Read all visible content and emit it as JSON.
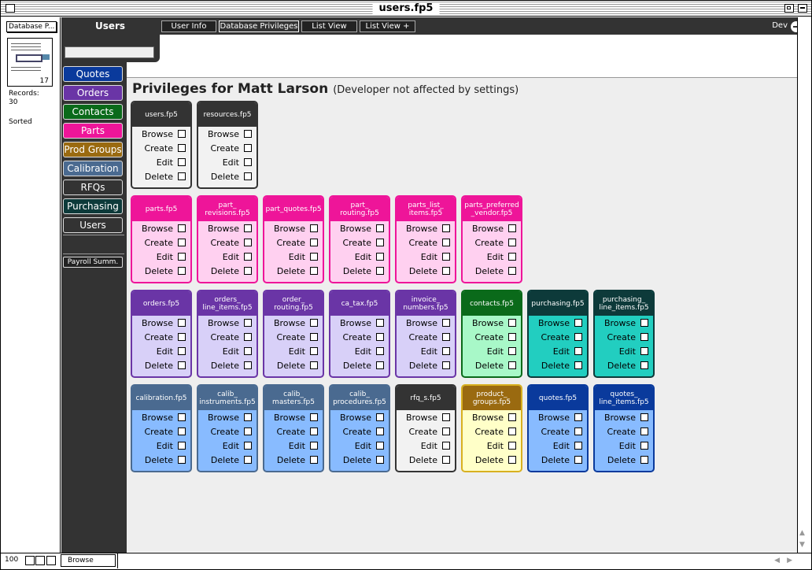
{
  "window": {
    "title": "users.fp5"
  },
  "status": {
    "db_popup": "Database P...",
    "record_num": "17",
    "records_label": "Records:",
    "records_count": "30",
    "sort_state": "Sorted"
  },
  "bottom": {
    "zoom": "100",
    "mode": "Browse"
  },
  "header": {
    "layout_title": "Users",
    "search_value": ""
  },
  "tabs": [
    {
      "label": "User Info"
    },
    {
      "label": "Database Privileges"
    },
    {
      "label": "List View"
    },
    {
      "label": "List View +"
    }
  ],
  "dev": {
    "label": "Dev"
  },
  "nav": [
    {
      "label": "Quotes",
      "color": "#0a3a9c"
    },
    {
      "label": "Orders",
      "color": "#6a35a6"
    },
    {
      "label": "Contacts",
      "color": "#0a6a1a"
    },
    {
      "label": "Parts",
      "color": "#ee1599"
    },
    {
      "label": "Prod Groups",
      "color": "#9a6a10"
    },
    {
      "label": "Calibration",
      "color": "#4a6a90"
    },
    {
      "label": "RFQs",
      "color": "#333333"
    },
    {
      "label": "Purchasing",
      "color": "#0d3a3a"
    },
    {
      "label": "Users",
      "color": "#333333"
    }
  ],
  "payroll": {
    "label": "Payroll Summ."
  },
  "main": {
    "heading": "Privileges for Matt Larson",
    "subheading": "(Developer not affected by settings)"
  },
  "row_labels": [
    "Browse",
    "Create",
    "Edit",
    "Delete"
  ],
  "cards": [
    [
      {
        "name": "users.fp5",
        "theme": "dark"
      },
      {
        "name": "resources.fp5",
        "theme": "dark"
      }
    ],
    [
      {
        "name": "parts.fp5",
        "theme": "pink"
      },
      {
        "name": "part_\nrevisions.fp5",
        "theme": "pink"
      },
      {
        "name": "part_quotes.fp5",
        "theme": "pink"
      },
      {
        "name": "part_\nrouting.fp5",
        "theme": "pink"
      },
      {
        "name": "parts_list_\nitems.fp5",
        "theme": "pink"
      },
      {
        "name": "parts_preferred\n_vendor.fp5",
        "theme": "pink"
      }
    ],
    [
      {
        "name": "orders.fp5",
        "theme": "purple"
      },
      {
        "name": "orders_\nline_items.fp5",
        "theme": "purple"
      },
      {
        "name": "order_\nrouting.fp5",
        "theme": "purple"
      },
      {
        "name": "ca_tax.fp5",
        "theme": "purple"
      },
      {
        "name": "invoice_\nnumbers.fp5",
        "theme": "purple"
      },
      {
        "name": "contacts.fp5",
        "theme": "green"
      },
      {
        "name": "purchasing.fp5",
        "theme": "teal"
      },
      {
        "name": "purchasing_\nline_items.fp5",
        "theme": "teal"
      }
    ],
    [
      {
        "name": "calibration.fp5",
        "theme": "slate"
      },
      {
        "name": "calib_\ninstruments.fp5",
        "theme": "slate"
      },
      {
        "name": "calib_\nmasters.fp5",
        "theme": "slate"
      },
      {
        "name": "calib_\nprocedures.fp5",
        "theme": "slate"
      },
      {
        "name": "rfq_s.fp5",
        "theme": "dark"
      },
      {
        "name": "product_\ngroups.fp5",
        "theme": "gold"
      },
      {
        "name": "quotes.fp5",
        "theme": "navy"
      },
      {
        "name": "quotes_\nline_items.fp5",
        "theme": "navy"
      }
    ]
  ],
  "themes": {
    "dark": {
      "head": "#333333",
      "body": "#f2f2f2",
      "border": "#333333"
    },
    "pink": {
      "head": "#ee1599",
      "body": "#ffd0f0",
      "border": "#ee1599"
    },
    "purple": {
      "head": "#6a35a6",
      "body": "#d8d0f8",
      "border": "#6a35a6"
    },
    "green": {
      "head": "#0a6a1a",
      "body": "#a8f8c8",
      "border": "#0a6a1a"
    },
    "teal": {
      "head": "#0d3a3a",
      "body": "#22cec0",
      "border": "#0d3a3a"
    },
    "slate": {
      "head": "#4a6a90",
      "body": "#88bbff",
      "border": "#4a6a90"
    },
    "gold": {
      "head": "#9a6a10",
      "body": "#ffffc8",
      "border": "#d8b020"
    },
    "navy": {
      "head": "#0a3a9c",
      "body": "#88bbff",
      "border": "#0a3a9c"
    }
  }
}
